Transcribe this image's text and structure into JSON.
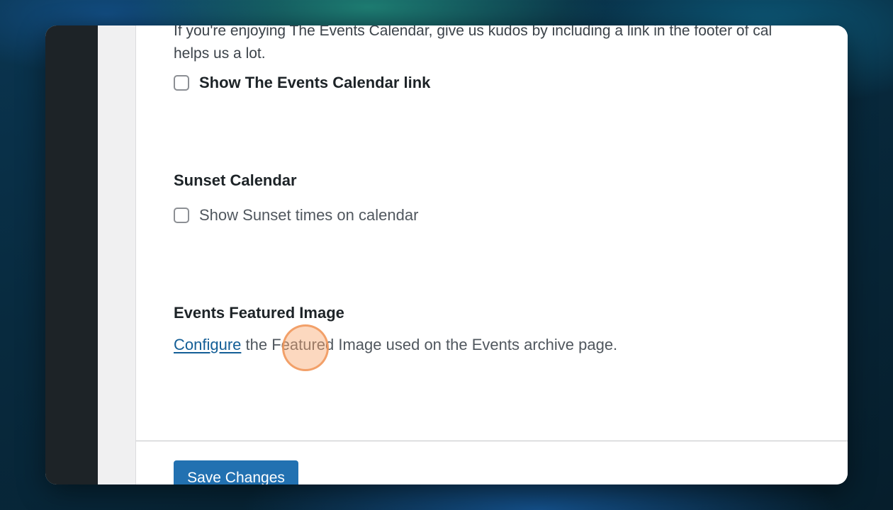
{
  "colors": {
    "sidebar": "#1d2327",
    "link": "#135e96",
    "primary_button": "#2271b1",
    "click_indicator": "#f8a870"
  },
  "credit": {
    "intro_line_1": "If you're enjoying The Events Calendar, give us kudos by including a link in the footer of cal",
    "intro_line_2": "helps us a lot.",
    "show_link_label": "Show The Events Calendar link"
  },
  "sunset": {
    "title": "Sunset Calendar",
    "checkbox_label": "Show Sunset times on calendar"
  },
  "featured_image": {
    "title": "Events Featured Image",
    "link_text": "Configure",
    "description": " the Featured Image used on the Events archive page."
  },
  "footer": {
    "save_label": "Save Changes"
  }
}
